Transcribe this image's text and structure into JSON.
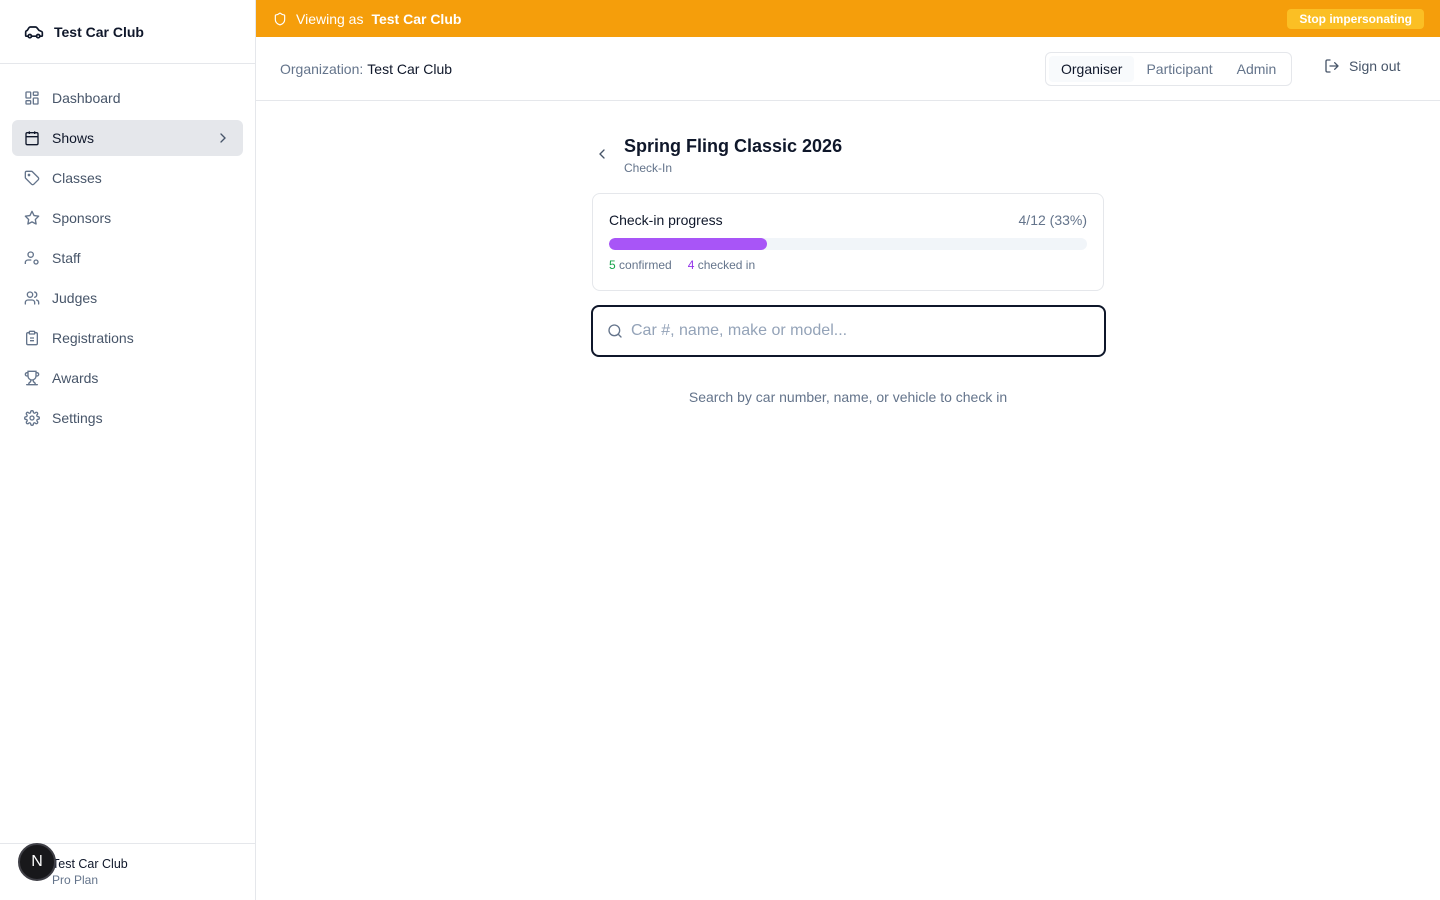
{
  "brand": {
    "name": "Test Car Club",
    "icon": "car-icon"
  },
  "sidebar": {
    "items": [
      {
        "label": "Dashboard",
        "icon": "dashboard-icon",
        "active": false
      },
      {
        "label": "Shows",
        "icon": "calendar-icon",
        "active": true
      },
      {
        "label": "Classes",
        "icon": "tag-icon",
        "active": false
      },
      {
        "label": "Sponsors",
        "icon": "star-icon",
        "active": false
      },
      {
        "label": "Staff",
        "icon": "user-cog-icon",
        "active": false
      },
      {
        "label": "Judges",
        "icon": "users-icon",
        "active": false
      },
      {
        "label": "Registrations",
        "icon": "clipboard-icon",
        "active": false
      },
      {
        "label": "Awards",
        "icon": "trophy-icon",
        "active": false
      },
      {
        "label": "Settings",
        "icon": "gear-icon",
        "active": false
      }
    ],
    "footer": {
      "name": "Test Car Club",
      "plan": "Pro Plan",
      "avatar_letter": "N"
    }
  },
  "banner": {
    "viewing_label": "Viewing as",
    "viewing_org": "Test Car Club",
    "stop_label": "Stop impersonating",
    "color": "#f59e0b"
  },
  "header": {
    "org_label": "Organization:",
    "org_name": "Test Car Club",
    "roles": [
      "Organiser",
      "Participant",
      "Admin"
    ],
    "active_role": "Organiser",
    "signout_label": "Sign out"
  },
  "page": {
    "title": "Spring Fling Classic 2026",
    "subtitle": "Check-In"
  },
  "progress": {
    "title": "Check-in progress",
    "count_text": "4/12 (33%)",
    "fraction": 0.33,
    "confirmed_num": "5",
    "confirmed_label": "confirmed",
    "checked_num": "4",
    "checked_label": "checked in",
    "bar_color": "#a855f7"
  },
  "search": {
    "placeholder": "Car #, name, make or model...",
    "value": "",
    "hint": "Search by car number, name, or vehicle to check in"
  }
}
